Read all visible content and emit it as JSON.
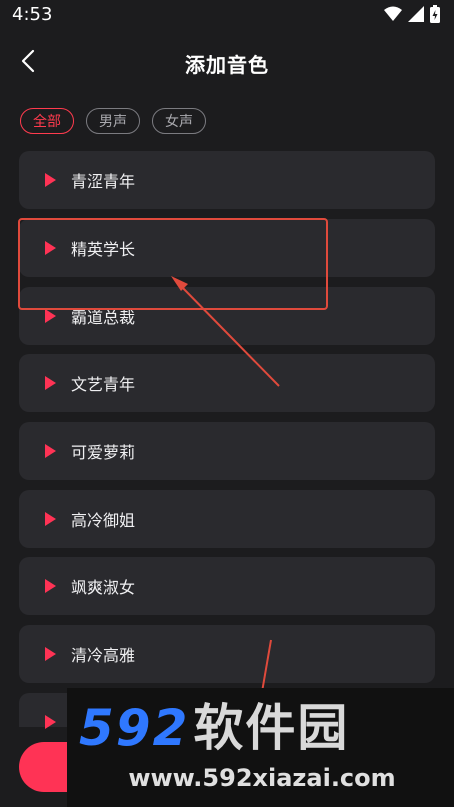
{
  "status_bar": {
    "time": "4:53"
  },
  "header": {
    "title": "添加音色"
  },
  "filters": [
    "全部",
    "男声",
    "女声"
  ],
  "voices": [
    "青涩青年",
    "精英学长",
    "霸道总裁",
    "文艺青年",
    "可爱萝莉",
    "高冷御姐",
    "飒爽淑女",
    "清冷高雅",
    ""
  ],
  "watermark": {
    "logo_number": "592",
    "logo_text": "软件园",
    "url": "www.592xiazai.com"
  },
  "colors": {
    "accent": "#ff3355",
    "background": "#1c1c1e",
    "card": "#2a2a2e",
    "annotation": "#e04a3c",
    "watermark_blue": "#2f78ff"
  }
}
